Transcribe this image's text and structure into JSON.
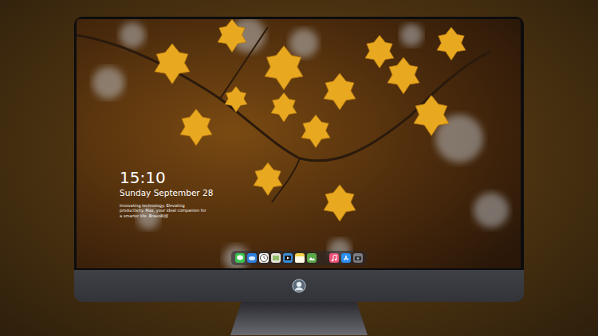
{
  "screen": {
    "clock": {
      "time": "15:10",
      "date": "Sunday September 28",
      "tagline": "Innovating technology. Elevating productivity. Max, your ideal companion for a smarter life. Bravo科技"
    },
    "dock": {
      "items": [
        {
          "kind": "messages"
        },
        {
          "kind": "finder"
        },
        {
          "kind": "clock"
        },
        {
          "kind": "photos"
        },
        {
          "kind": "video"
        },
        {
          "kind": "notes"
        },
        {
          "kind": "preview"
        },
        {
          "kind": "separator"
        },
        {
          "kind": "music"
        },
        {
          "kind": "appstore"
        },
        {
          "kind": "camera"
        }
      ]
    }
  }
}
